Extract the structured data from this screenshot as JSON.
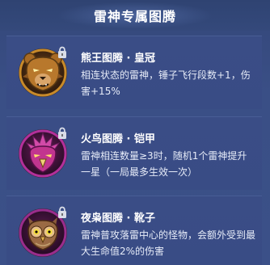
{
  "title": "雷神专属图腾",
  "totems": [
    {
      "name": "熊王图腾 · 皇冠",
      "desc": "相连状态的雷神，锤子飞行段数+1，伤害+15%",
      "icon": "bear-crown-icon",
      "locked": true
    },
    {
      "name": "火鸟图腾 · 铠甲",
      "desc": "雷神相连数量≥3时，随机1个雷神提升一星（一局最多生效一次）",
      "icon": "firebird-armor-icon",
      "locked": true
    },
    {
      "name": "夜枭图腾 · 靴子",
      "desc": "雷神普攻落雷中心的怪物，会额外受到最大生命值2%的伤害",
      "icon": "owl-boots-icon",
      "locked": true
    }
  ],
  "colors": {
    "bear_ring": "#c88a2a",
    "bird_ring": "#b3309a",
    "owl_ring": "#9a2d8c"
  }
}
